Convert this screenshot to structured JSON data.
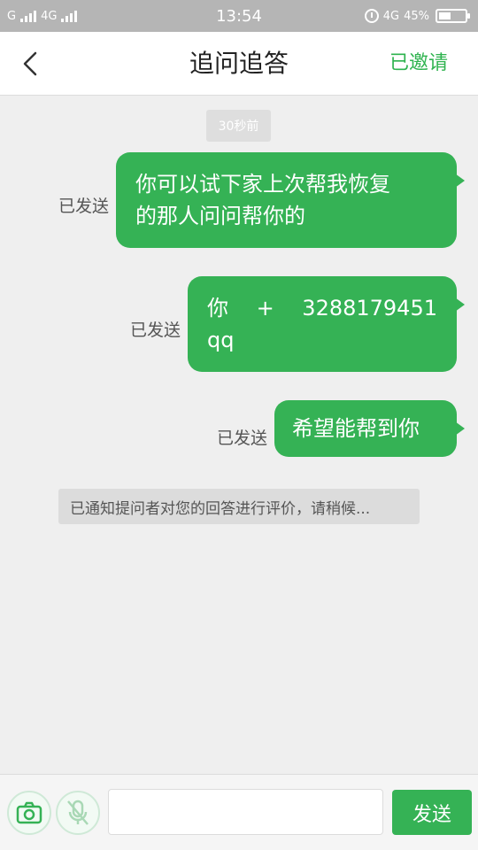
{
  "status_bar": {
    "carrier1": "G",
    "carrier2": "4G",
    "time": "13:54",
    "network": "4G",
    "battery": "45%",
    "icons": [
      "signal-icon",
      "alarm-icon",
      "battery-icon"
    ]
  },
  "header": {
    "title": "追问追答",
    "right_action": "已邀请",
    "back_icon": "chevron-left-icon"
  },
  "chat": {
    "timestamp": "30秒前",
    "messages": [
      {
        "status": "已发送",
        "lines": [
          "你可以试下家上次帮我恢复",
          "的那人问问帮你的"
        ]
      },
      {
        "status": "已发送",
        "parts": [
          "你",
          "+",
          "3288179451"
        ],
        "line2": "qq"
      },
      {
        "status": "已发送",
        "lines": [
          "希望能帮到你"
        ]
      }
    ],
    "notice": "已通知提问者对您的回答进行评价，请稍候..."
  },
  "input_bar": {
    "placeholder": "",
    "send_label": "发送",
    "icons": [
      "camera-icon",
      "mic-off-icon"
    ]
  },
  "colors": {
    "accent": "#35b255",
    "status_bar_bg": "#b5b5b5",
    "chat_bg": "#efefef"
  }
}
